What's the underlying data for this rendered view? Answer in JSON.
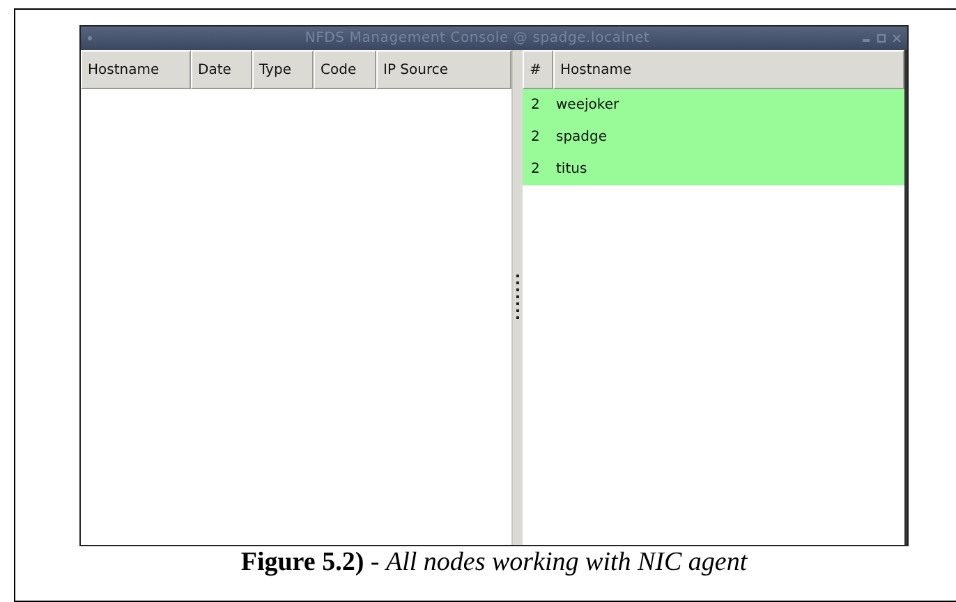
{
  "window": {
    "title": "NFDS Management Console @ spadge.localnet"
  },
  "events_table": {
    "columns": [
      "Hostname",
      "Date",
      "Type",
      "Code",
      "IP Source"
    ]
  },
  "nodes_table": {
    "columns": [
      "#",
      "Hostname"
    ],
    "rows": [
      {
        "count": "2",
        "hostname": "weejoker",
        "color": "#98fb98"
      },
      {
        "count": "2",
        "hostname": "spadge",
        "color": "#98fb98"
      },
      {
        "count": "2",
        "hostname": "titus",
        "color": "#98fb98"
      }
    ]
  },
  "caption": "**Figure 5.2)** - *All nodes working with NIC agent*"
}
